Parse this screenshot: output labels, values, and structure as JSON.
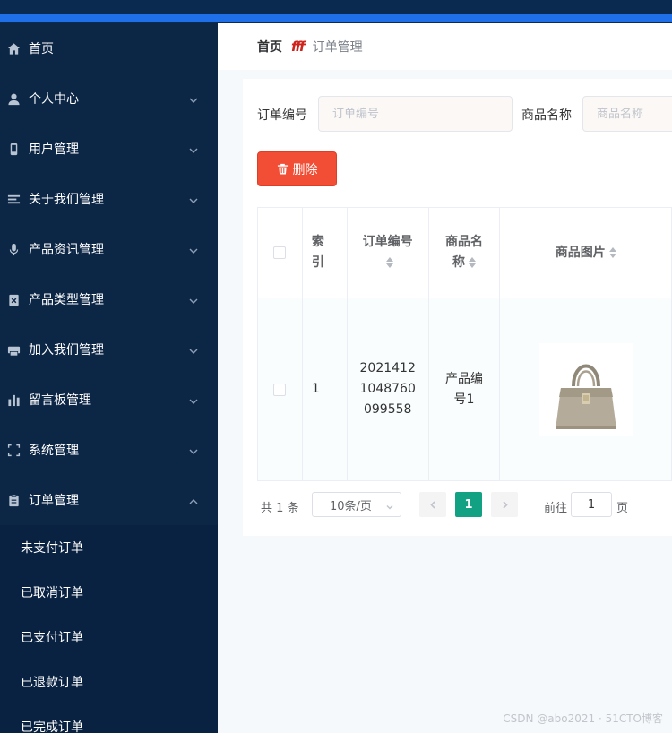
{
  "colors": {
    "sidebar_bg": "#0c2646",
    "topbar_bg": "#0b2a4f",
    "topbar_accent": "#1e6fe8",
    "delete_button": "#f24d35",
    "active_page": "#12a182"
  },
  "sidebar": {
    "items": [
      {
        "label": "首页",
        "icon": "home-icon",
        "expandable": false
      },
      {
        "label": "个人中心",
        "icon": "user-icon",
        "expandable": true
      },
      {
        "label": "用户管理",
        "icon": "phone-icon",
        "expandable": true
      },
      {
        "label": "关于我们管理",
        "icon": "list-icon",
        "expandable": true
      },
      {
        "label": "产品资讯管理",
        "icon": "microphone-icon",
        "expandable": true
      },
      {
        "label": "产品类型管理",
        "icon": "clipboard-x-icon",
        "expandable": true
      },
      {
        "label": "加入我们管理",
        "icon": "printer-icon",
        "expandable": true
      },
      {
        "label": "留言板管理",
        "icon": "bar-chart-icon",
        "expandable": true
      },
      {
        "label": "系统管理",
        "icon": "frame-icon",
        "expandable": true
      },
      {
        "label": "订单管理",
        "icon": "clipboard-icon",
        "expandable": true,
        "expanded": true
      }
    ],
    "order_submenu": [
      "未支付订单",
      "已取消订单",
      "已支付订单",
      "已退款订单",
      "已完成订单"
    ]
  },
  "breadcrumb": {
    "home": "首页",
    "separator": "fff",
    "current": "订单管理"
  },
  "search": {
    "order_no_label": "订单编号",
    "order_no_placeholder": "订单编号",
    "order_no_value": "",
    "product_name_label": "商品名称",
    "product_name_placeholder": "商品名称",
    "product_name_value": ""
  },
  "toolbar": {
    "delete_label": "删除"
  },
  "table": {
    "headers": {
      "index_line1": "索",
      "index_line2": "引",
      "order_no": "订单编号",
      "product_name_line1": "商品名",
      "product_name_line2": "称",
      "product_image": "商品图片"
    },
    "rows": [
      {
        "index": "1",
        "order_no_line1": "2021412",
        "order_no_line2": "1048760",
        "order_no_line3": "099558",
        "product_name_line1": "产品编",
        "product_name_line2": "号1",
        "product_image": "handbag-image"
      }
    ]
  },
  "pagination": {
    "total_text": "共 1 条",
    "page_size": "10条/页",
    "current_page": "1",
    "goto_label": "前往",
    "goto_value": "1",
    "page_unit": "页"
  },
  "watermark": "CSDN @abo2021 · 51CTO博客"
}
